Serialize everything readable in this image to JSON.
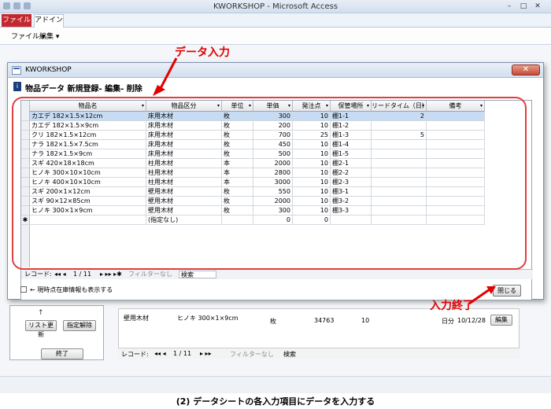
{
  "app": {
    "title": "KWORKSHOP - Microsoft Access",
    "tab_file": "ファイル",
    "tab_addin": "アドイン",
    "menu_file": "ファイル ▾",
    "menu_edit": "編集 ▾"
  },
  "dialog": {
    "title": "KWORKSHOP",
    "close_glyph": "✕",
    "subtitle": "物品データ 新規登録- 編集- 削除"
  },
  "sheet": {
    "columns": [
      "物品名",
      "物品区分",
      "単位",
      "単価",
      "発注点",
      "保管場所",
      "リードタイム（日）",
      "備考"
    ],
    "rows": [
      [
        "カエデ 182×1.5×12cm",
        "床用木材",
        "枚",
        "300",
        "10",
        "棚1-1",
        "2",
        ""
      ],
      [
        "カエデ 182×1.5×9cm",
        "床用木材",
        "枚",
        "200",
        "10",
        "棚1-2",
        "",
        ""
      ],
      [
        "クリ 182×1.5×12cm",
        "床用木材",
        "枚",
        "700",
        "25",
        "棚1-3",
        "5",
        ""
      ],
      [
        "ナラ 182×1.5×7.5cm",
        "床用木材",
        "枚",
        "450",
        "10",
        "棚1-4",
        "",
        ""
      ],
      [
        "ナラ 182×1.5×9cm",
        "床用木材",
        "枚",
        "500",
        "10",
        "棚1-5",
        "",
        ""
      ],
      [
        "スギ 420×18×18cm",
        "柱用木材",
        "本",
        "2000",
        "10",
        "棚2-1",
        "",
        ""
      ],
      [
        "ヒノキ 300×10×10cm",
        "柱用木材",
        "本",
        "2800",
        "10",
        "棚2-2",
        "",
        ""
      ],
      [
        "ヒノキ 400×10×10cm",
        "柱用木材",
        "本",
        "3000",
        "10",
        "棚2-3",
        "",
        ""
      ],
      [
        "スギ 200×1×12cm",
        "壁用木材",
        "枚",
        "550",
        "10",
        "棚3-1",
        "",
        ""
      ],
      [
        "スギ 90×12×85cm",
        "壁用木材",
        "枚",
        "2000",
        "10",
        "棚3-2",
        "",
        ""
      ],
      [
        "ヒノキ 300×1×9cm",
        "壁用木材",
        "枚",
        "300",
        "10",
        "棚3-3",
        "",
        ""
      ]
    ],
    "new_row": {
      "marker": "✱",
      "category": "(指定なし)",
      "price": "0",
      "reorder": "0"
    },
    "nav": {
      "label": "レコード:",
      "position": "1 / 11",
      "filter": "フィルターなし",
      "search": "検索"
    },
    "show_stock_label": "← 現時点在庫情報も表示する",
    "close_button": "閉じる"
  },
  "background": {
    "button_refresh": "リスト更新",
    "button_unselect": "指定解除",
    "button_exit": "終了",
    "row_category": "壁用木材",
    "row_name": "ヒノキ 300×1×9cm",
    "row_unit": "枚",
    "row_value": "34763",
    "row_qty": "10",
    "row_days": "日分",
    "row_date": "10/12/28",
    "row_edit": "編集",
    "nav_label": "レコード:",
    "nav_position": "1 / 11",
    "nav_filter": "フィルターなし",
    "nav_search": "検索"
  },
  "annotations": {
    "data_entry": "データ入力",
    "entry_done": "入力終了",
    "accent_color": "#e30000"
  },
  "caption": "(2) データシートの各入力項目にデータを入力する"
}
